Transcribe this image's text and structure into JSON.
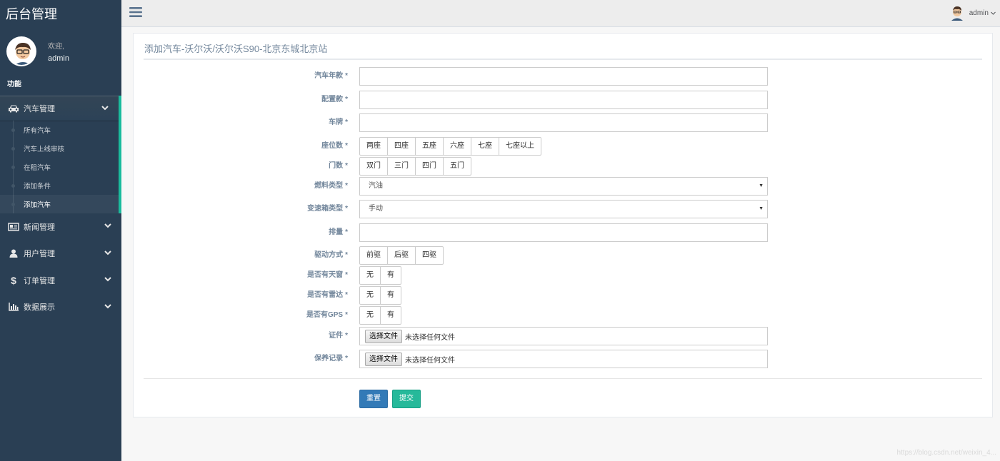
{
  "app": {
    "brand": "后台管理",
    "profile": {
      "welcome": "欢迎,",
      "username": "admin"
    },
    "section_title": "功能"
  },
  "sidebar": {
    "car_menu": {
      "label": "汽车管理",
      "icon": "car-icon",
      "items": [
        {
          "label": "所有汽车"
        },
        {
          "label": "汽车上线审核"
        },
        {
          "label": "在租汽车"
        },
        {
          "label": "添加条件"
        },
        {
          "label": "添加汽车"
        }
      ]
    },
    "news_menu": {
      "label": "新闻管理",
      "icon": "newspaper-icon"
    },
    "user_menu": {
      "label": "用户管理",
      "icon": "user-icon"
    },
    "order_menu": {
      "label": "订单管理",
      "icon": "dollar-icon"
    },
    "data_menu": {
      "label": "数据展示",
      "icon": "bar-chart-icon"
    }
  },
  "topnav": {
    "username": "admin",
    "toggle_icon": "hamburger-icon"
  },
  "form": {
    "title": "添加汽车-沃尔沃/沃尔沃S90-北京东城北京站",
    "required_mark": "*",
    "year_label": "汽车年款",
    "config_label": "配置款",
    "plate_label": "车牌",
    "seats": {
      "label": "座位数",
      "options": [
        "两座",
        "四座",
        "五座",
        "六座",
        "七座",
        "七座以上"
      ]
    },
    "doors": {
      "label": "门数",
      "options": [
        "双门",
        "三门",
        "四门",
        "五门"
      ]
    },
    "fuel": {
      "label": "燃料类型",
      "value": "汽油"
    },
    "gearbox": {
      "label": "变速箱类型",
      "value": "手动"
    },
    "displacement_label": "排量",
    "drive": {
      "label": "驱动方式",
      "options": [
        "前驱",
        "后驱",
        "四驱"
      ]
    },
    "sunroof": {
      "label": "是否有天窗",
      "options": [
        "无",
        "有"
      ]
    },
    "radar": {
      "label": "是否有雷达",
      "options": [
        "无",
        "有"
      ]
    },
    "gps": {
      "label": "是否有GPS",
      "options": [
        "无",
        "有"
      ]
    },
    "certificate": {
      "label": "证件",
      "button": "选择文件",
      "status": "未选择任何文件"
    },
    "maintenance": {
      "label": "保养记录",
      "button": "选择文件",
      "status": "未选择任何文件"
    },
    "reset_label": "重置",
    "submit_label": "提交"
  },
  "watermark": "https://blog.csdn.net/weixin_4...",
  "colors": {
    "sidebar": "#2A3F54",
    "accent": "#1ABB9C",
    "primary": "#337AB7",
    "success": "#26B99A"
  }
}
